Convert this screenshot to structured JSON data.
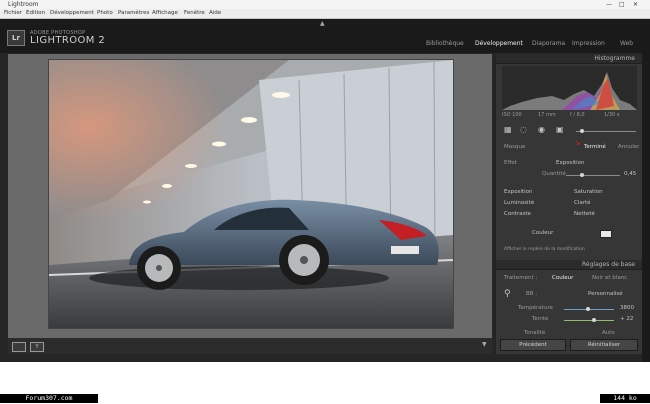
{
  "window": {
    "title": "Lightroom",
    "controls": [
      "—",
      "□",
      "✕"
    ]
  },
  "menu": [
    "Fichier",
    "Edition",
    "Développement",
    "Photo",
    "Paramètres",
    "Affichage",
    "Fenêtre",
    "Aide"
  ],
  "brand": {
    "top": "ADOBE PHOTOSHOP",
    "name": "LIGHTROOM 2"
  },
  "modules": [
    {
      "label": "Bibliothèque",
      "active": false
    },
    {
      "label": "Développement",
      "active": true
    },
    {
      "label": "Diaporama",
      "active": false
    },
    {
      "label": "Impression",
      "active": false
    },
    {
      "label": "Web",
      "active": false
    }
  ],
  "histogram": {
    "title": "Histogramme",
    "readouts": [
      "ISO 100",
      "17 mm",
      "f / 8,0",
      "1/30 s"
    ]
  },
  "develop_panel": {
    "tool_label_left": "Masque",
    "tool_label_mid": "Terminé",
    "tool_label_right": "Annuler",
    "effect_label": "Effet",
    "effect_value": "Exposition",
    "amount_label": "Quantité",
    "amount_value": "0,45",
    "rows": [
      {
        "left": "Exposition",
        "right": "Saturation"
      },
      {
        "left": "Luminosité",
        "right": "Clarté"
      },
      {
        "left": "Contraste",
        "right": "Netteté"
      }
    ],
    "color_label": "Couleur",
    "bottom_line": "Afficher le repère de la modification"
  },
  "basic_panel": {
    "title": "Réglages de base",
    "treatment_label": "Traitement :",
    "treatment_options": [
      "Couleur",
      "Noir et blanc"
    ],
    "wb_label": "BB :",
    "wb_value": "Personnalisé",
    "temp_label": "Température",
    "temp_value": "3800",
    "tint_label": "Teinte",
    "tint_value": "+ 22",
    "tone_label": "Tonalité",
    "auto_label": "Auto"
  },
  "buttons": {
    "previous": "Précédent",
    "reset": "Réinitialiser"
  },
  "toolbar": {
    "view_y_label": "Y"
  },
  "footer": {
    "site": "Forum307.com",
    "size": "144 ko"
  },
  "colors": {
    "bg": "#262626",
    "panel": "#363636",
    "accent_red": "#d41f1f"
  }
}
